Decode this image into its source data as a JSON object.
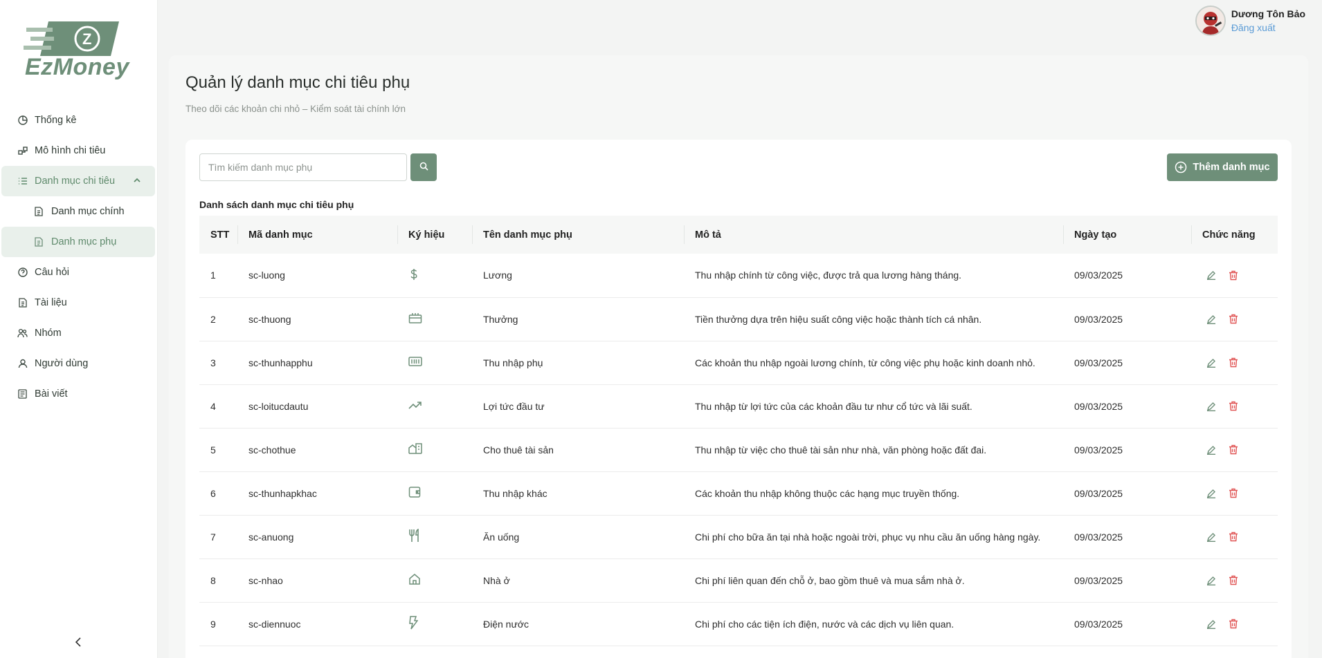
{
  "app": {
    "logo_text": "EzMoney"
  },
  "sidebar": {
    "items": [
      {
        "label": "Thống kê",
        "icon": "pie-chart-icon"
      },
      {
        "label": "Mô hình chi tiêu",
        "icon": "model-icon"
      },
      {
        "label": "Danh mục chi tiêu",
        "icon": "list-icon",
        "expanded": true
      },
      {
        "label": "Câu hỏi",
        "icon": "question-icon"
      },
      {
        "label": "Tài liệu",
        "icon": "document-icon"
      },
      {
        "label": "Nhóm",
        "icon": "group-icon"
      },
      {
        "label": "Người dùng",
        "icon": "user-icon"
      },
      {
        "label": "Bài viết",
        "icon": "article-icon"
      }
    ],
    "sub_items": [
      {
        "label": "Danh mục chính",
        "icon": "file-icon"
      },
      {
        "label": "Danh mục phụ",
        "icon": "file-icon",
        "active": true
      }
    ]
  },
  "header": {
    "user_name": "Dương Tôn Bảo",
    "logout": "Đăng xuất"
  },
  "page": {
    "title": "Quản lý danh mục chi tiêu phụ",
    "subtitle": "Theo dõi các khoản chi nhỏ – Kiểm soát tài chính lớn"
  },
  "search": {
    "placeholder": "Tìm kiếm danh mục phụ"
  },
  "add_button": {
    "label": "Thêm danh mục"
  },
  "list_title": "Danh sách danh mục chi tiêu phụ",
  "table": {
    "headers": [
      "STT",
      "Mã danh mục",
      "Ký hiệu",
      "Tên danh mục phụ",
      "Mô tả",
      "Ngày tạo",
      "Chức năng"
    ],
    "rows": [
      {
        "stt": "1",
        "code": "sc-luong",
        "icon": "dollar-icon",
        "name": "Lương",
        "desc": "Thu nhập chính từ công việc, được trả qua lương hàng tháng.",
        "date": "09/03/2025"
      },
      {
        "stt": "2",
        "code": "sc-thuong",
        "icon": "gift-icon",
        "name": "Thưởng",
        "desc": "Tiền thưởng dựa trên hiệu suất công việc hoặc thành tích cá nhân.",
        "date": "09/03/2025"
      },
      {
        "stt": "3",
        "code": "sc-thunhapphu",
        "icon": "cash-icon",
        "name": "Thu nhập phụ",
        "desc": "Các khoản thu nhập ngoài lương chính, từ công việc phụ hoặc kinh doanh nhỏ.",
        "date": "09/03/2025"
      },
      {
        "stt": "4",
        "code": "sc-loitucdautu",
        "icon": "trending-up-icon",
        "name": "Lợi tức đầu tư",
        "desc": "Thu nhập từ lợi tức của các khoản đầu tư như cổ tức và lãi suất.",
        "date": "09/03/2025"
      },
      {
        "stt": "5",
        "code": "sc-chothue",
        "icon": "building-icon",
        "name": "Cho thuê tài sản",
        "desc": "Thu nhập từ việc cho thuê tài sản như nhà, văn phòng hoặc đất đai.",
        "date": "09/03/2025"
      },
      {
        "stt": "6",
        "code": "sc-thunhapkhac",
        "icon": "wallet-icon",
        "name": "Thu nhập khác",
        "desc": "Các khoản thu nhập không thuộc các hạng mục truyền thống.",
        "date": "09/03/2025"
      },
      {
        "stt": "7",
        "code": "sc-anuong",
        "icon": "utensils-icon",
        "name": "Ăn uống",
        "desc": "Chi phí cho bữa ăn tại nhà hoặc ngoài trời, phục vụ nhu cầu ăn uống hàng ngày.",
        "date": "09/03/2025"
      },
      {
        "stt": "8",
        "code": "sc-nhao",
        "icon": "home-icon",
        "name": "Nhà ở",
        "desc": "Chi phí liên quan đến chỗ ở, bao gồm thuê và mua sắm nhà ở.",
        "date": "09/03/2025"
      },
      {
        "stt": "9",
        "code": "sc-diennuoc",
        "icon": "bolt-icon",
        "name": "Điện nước",
        "desc": "Chi phí cho các tiện ích điện, nước và các dịch vụ liên quan.",
        "date": "09/03/2025"
      }
    ]
  },
  "colors": {
    "accent": "#6e8f79",
    "delete": "#e05454",
    "link": "#5a9bd6"
  }
}
